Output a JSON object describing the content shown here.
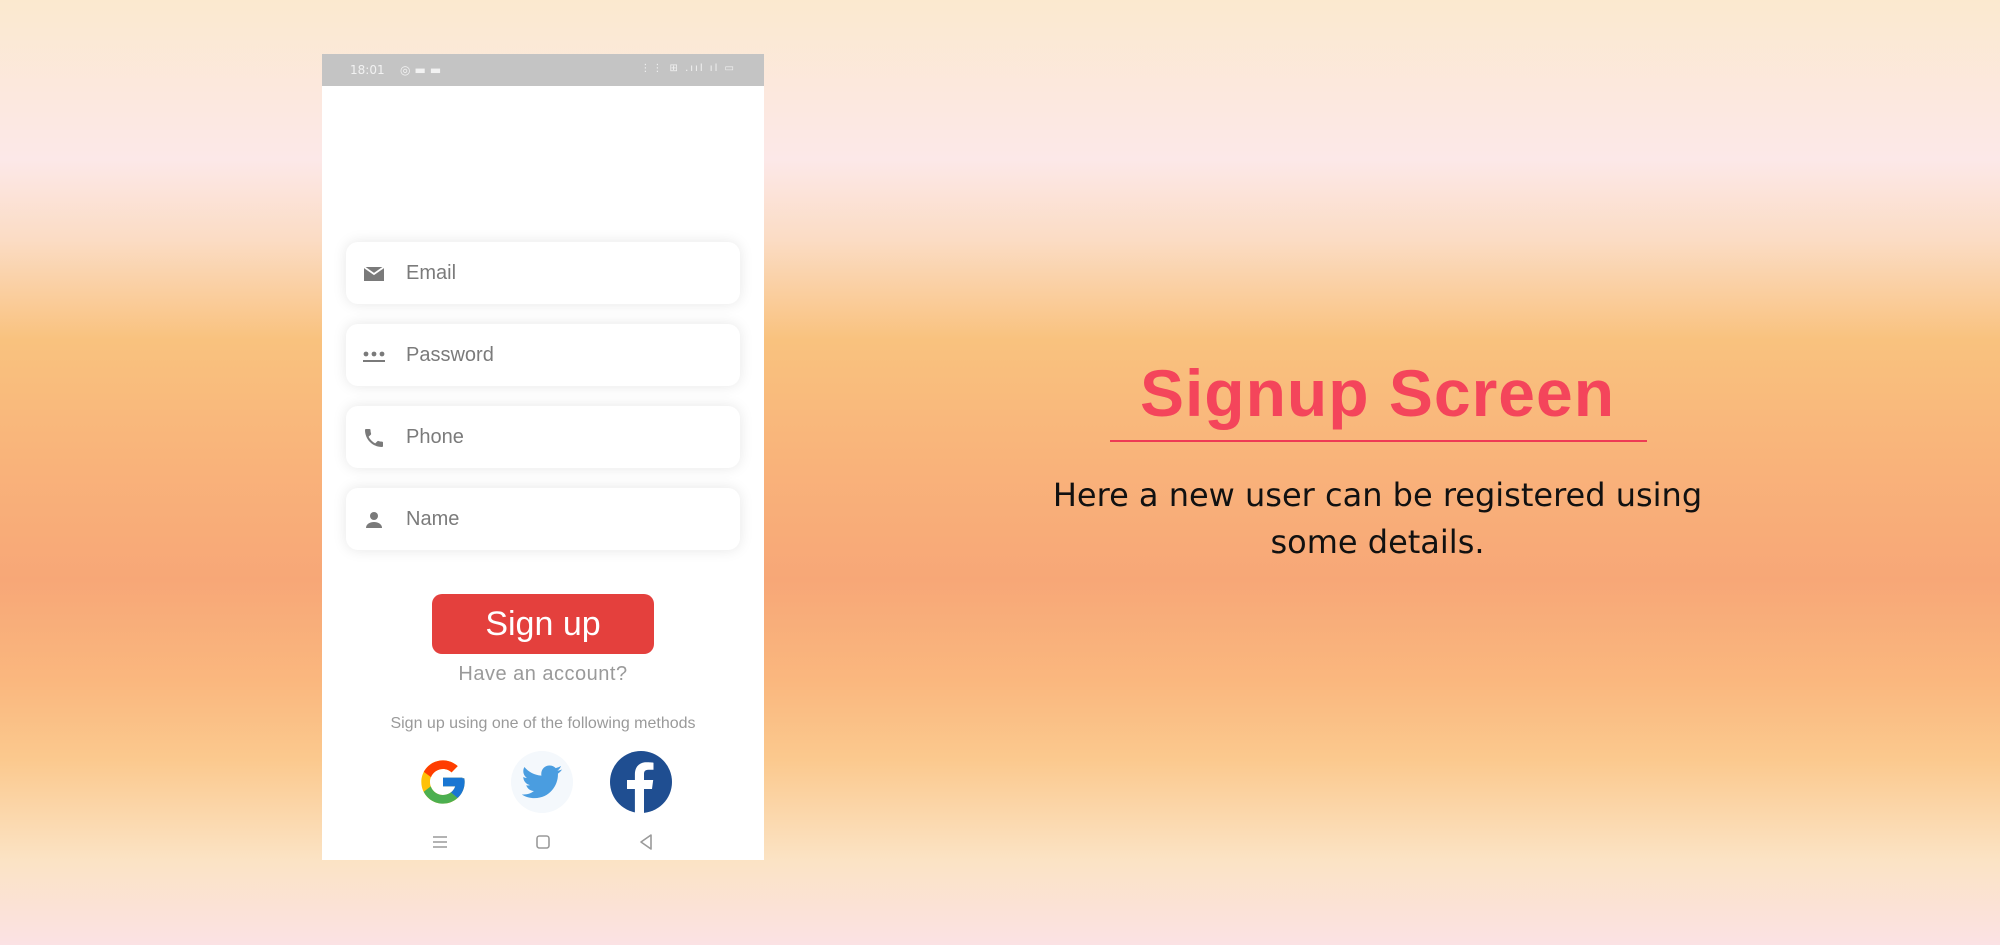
{
  "phone": {
    "status_bar": {
      "time": "18:01",
      "notification_icons": [
        "whatsapp-icon",
        "message-icon",
        "message-icon"
      ],
      "right_indicators": [
        "network-speed",
        "volte",
        "signal",
        "signal",
        "battery"
      ]
    },
    "form": {
      "fields": [
        {
          "icon": "mail-icon",
          "placeholder": "Email"
        },
        {
          "icon": "password-icon",
          "placeholder": "Password"
        },
        {
          "icon": "phone-icon",
          "placeholder": "Phone"
        },
        {
          "icon": "person-icon",
          "placeholder": "Name"
        }
      ],
      "signup_label": "Sign up",
      "have_account": "Have an account?",
      "methods_text": "Sign up using one of the following methods",
      "social_icons": [
        "google-icon",
        "twitter-icon",
        "facebook-icon"
      ]
    },
    "nav_bar": [
      "menu-icon",
      "home-icon",
      "back-icon"
    ]
  },
  "slide": {
    "title": "Signup Screen",
    "description_lines": [
      "Here a new user can be registered using",
      "some details."
    ]
  },
  "colors": {
    "title": "#f4455b",
    "signup_button": "#e4403d",
    "facebook": "#1f4e91",
    "twitter": "#4a9de0"
  }
}
